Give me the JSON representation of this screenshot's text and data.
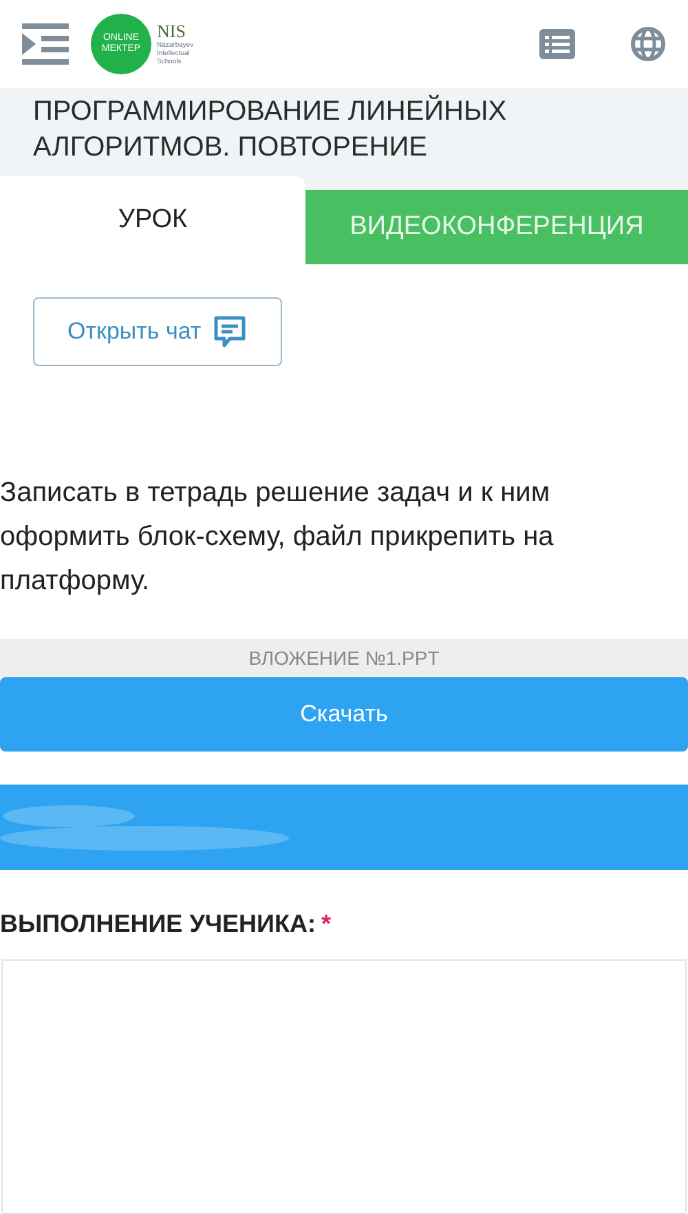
{
  "header": {
    "logo_text": "ONLINE МЕКТЕР",
    "partner_logo": {
      "name": "NIS",
      "subtitle": "Nazarbayev Intellectual Schools"
    }
  },
  "lesson_title": "ПРОГРАММИРОВАНИЕ ЛИНЕЙНЫХ АЛГОРИТМОВ. ПОВТОРЕНИЕ",
  "tabs": [
    {
      "label": "УРОК",
      "selected": true
    },
    {
      "label": "ВИДЕОКОНФЕРЕНЦИЯ",
      "selected": false
    }
  ],
  "chat_button": "Открыть чат",
  "task_text": "Записать в тетрадь решение задач и к ним оформить блок-схему, файл прикрепить на платформу.",
  "attachment": {
    "name": "ВЛОЖЕНИЕ №1.PPT",
    "button": "Скачать"
  },
  "answer": {
    "label": "ВЫПОЛНЕНИЕ УЧЕНИКА:",
    "required_mark": "*"
  }
}
